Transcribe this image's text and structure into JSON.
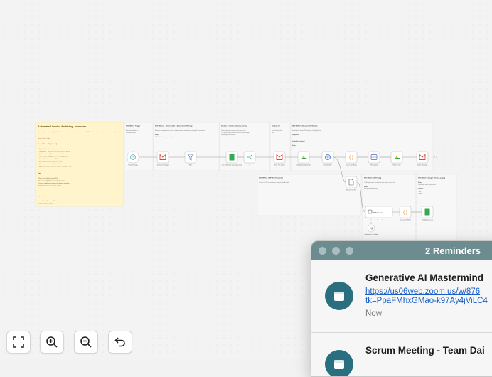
{
  "note": {
    "title": "Automated Invoice Archiving - overview",
    "intro": "This workflow automatically collects invoice emails from your Gmail, extracts PDF attachments, and archives them in Google Drive.",
    "demo": "Demo: Watch Video",
    "how_heading": "How it Works (High Level)",
    "steps": [
      "1. Trigger - Runs at your chosen interval",
      "2. Gmail Fetch - Retrieves new messages from Gmail",
      "3. Attachment Loop - Processes each attachment",
      "4. Save to Drive - Uploads the PDF to Google Drive",
      "5. Extract Text - Extracts the PDF text",
      "6. AI Parsing - Identifies key invoice data",
      "7. Rename - Renames the file with the invoice data",
      "8. Append to Sheets - Logs the invoice in Google Sheets"
    ],
    "tips_heading": "Tips",
    "tips": [
      "- Works best with text-based PDFs",
      "- OCR / scanned PDFs may need extra steps",
      "- You can use different prompts for different providers",
      "- Folders can be set by client or vendor"
    ],
    "important_heading": "Important",
    "important": [
      "Connect Gmail, Drive and Sheets",
      "credentials before running."
    ]
  },
  "sections": {
    "s1": {
      "title": "SECTION 1: Trigger",
      "lines": [
        "Runs this workflow at a",
        "scheduled interval"
      ]
    },
    "s2": {
      "title": "SECTION 2.1 - Gmail Intake & Attachment Filtering",
      "lines": [
        "Retrieves messages from a specific sender and filters only emails containing PDF attachments.",
        "Setup:",
        "1. Filter Gmail messages, enter the sender email."
      ]
    },
    "s3": {
      "title": "Section 3: Check if already existing",
      "lines": [
        "Prevents duplicate processing of the same email.",
        "This section checks whether the current email message",
        "has already been processed."
      ]
    },
    "s4": {
      "title": "Section 2.2",
      "lines": [
        "Get attachments from",
        "Gmail"
      ]
    },
    "s5": {
      "title": "SECTION 5 - Structured & Storage",
      "lines": [
        "Downloads the Invoice PDF and saves it to Google Drive.",
        "Google Drive",
        "Google Drive (optional)",
        "Setup:"
      ]
    },
    "s6": {
      "title": "SECTION 4 - PDF Text Extraction",
      "lines": [
        "Converts the PDF into text before sending it to the AI model."
      ]
    },
    "s7": {
      "title": "SECTION 5 - AI Parsing",
      "lines": [
        "The AI agent extracts structured data (date, vendor, amount, tax).",
        "Setup:",
        "Enter your AI model API key."
      ]
    },
    "s8": {
      "title": "SECTION 6 - Google Sheets Logging",
      "lines": [
        "Setup:",
        "Connect your Google Sheets account",
        "Columns:",
        "- Date",
        "- Vendor",
        "- Amount"
      ]
    }
  },
  "nodes": {
    "schedule": "Schedule Trigger",
    "get_messages": "Get many messages",
    "filter": "Filter",
    "check": "Check: Message already processed",
    "if": "If",
    "gmail": "Gmail: Get_Invoice",
    "drive_upload": "GoogleDrive Upload File",
    "download": "Download file",
    "code": "Code in JavaScript",
    "pdf_upload": "PDF upload",
    "rename": "Rename a file",
    "gmail2": "Delete a message",
    "extract": "Extract From File",
    "agent": "AI Agent Data",
    "parse": "Code_extract/Fields",
    "sheets": "GoogleSheets_Log",
    "openrouter": "OpenRouter Chat Model"
  },
  "zoom_controls": {
    "fit": "fit-view",
    "zoom_in": "zoom-in",
    "zoom_out": "zoom-out",
    "reset": "reset-zoom"
  },
  "reminders": {
    "window_title": "2 Reminders",
    "items": [
      {
        "title": "Generative AI Mastermind",
        "link_line1": "https://us06web.zoom.us/w/876",
        "link_line2": "tk=PpaFMhxGMao-k97Ay4jViLC4",
        "time": "Now"
      },
      {
        "title": "Scrum Meeting - Team Dai"
      }
    ]
  },
  "colors": {
    "sticky_yellow": "#fff4cc",
    "gmail_red": "#ea4335",
    "drive_green": "#34a853",
    "reminder_accent": "#2a6f7f",
    "titlebar": "#6c8c90"
  }
}
